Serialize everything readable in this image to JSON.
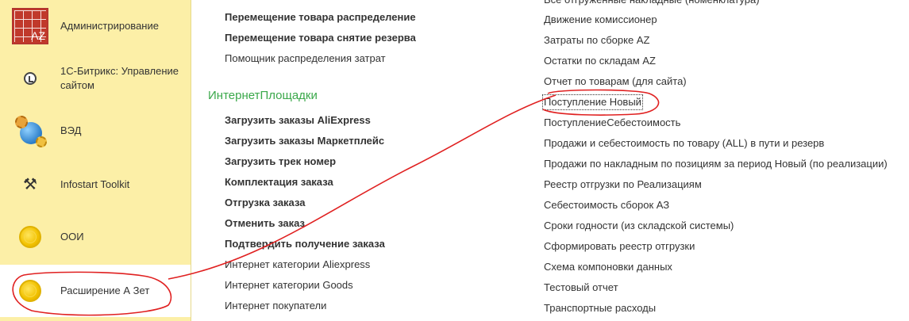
{
  "sidebar": {
    "items": [
      {
        "label": "Администрирование",
        "icon": "az-logo-icon"
      },
      {
        "label": "1С-Битрикс: Управление сайтом",
        "icon": "bitrix-icon"
      },
      {
        "label": "ВЭД",
        "icon": "globe-gears-icon"
      },
      {
        "label": "Infostart Toolkit",
        "icon": "tools-icon"
      },
      {
        "label": "ООИ",
        "icon": "coin-icon"
      },
      {
        "label": "Расширение А Зет",
        "icon": "coin-icon"
      }
    ],
    "active_index": 5
  },
  "column1": {
    "top_items": [
      {
        "label": "Перемещение товара распределение",
        "bold": true
      },
      {
        "label": "Перемещение товара снятие резерва",
        "bold": true
      },
      {
        "label": "Помощник распределения затрат",
        "bold": false
      }
    ],
    "section_title": "ИнтернетПлощадки",
    "section_items": [
      {
        "label": "Загрузить заказы AliExpress",
        "bold": true
      },
      {
        "label": "Загрузить заказы Маркетплейс",
        "bold": true
      },
      {
        "label": "Загрузить трек номер",
        "bold": true
      },
      {
        "label": "Комплектация заказа",
        "bold": true
      },
      {
        "label": "Отгрузка заказа",
        "bold": true
      },
      {
        "label": "Отменить заказ",
        "bold": true
      },
      {
        "label": "Подтвердить получение заказа",
        "bold": true
      },
      {
        "label": "Интернет категории Aliexpress",
        "bold": false
      },
      {
        "label": "Интернет категории Goods",
        "bold": false
      },
      {
        "label": "Интернет покупатели",
        "bold": false
      }
    ]
  },
  "column2": {
    "items": [
      {
        "label": "Все отгруженные накладные (номенклатура)"
      },
      {
        "label": "Движение комиссионер"
      },
      {
        "label": "Затраты по сборке AZ"
      },
      {
        "label": "Остатки по складам AZ"
      },
      {
        "label": "Отчет по товарам (для сайта)"
      },
      {
        "label": "Поступление Новый"
      },
      {
        "label": "ПоступлениеСебестоимость"
      },
      {
        "label": "Продажи и себестоимость по товару (ALL) в пути и резерв"
      },
      {
        "label": "Продажи по накладным по позициям за период Новый (по реализации)"
      },
      {
        "label": "Реестр отгрузки по Реализациям"
      },
      {
        "label": "Себестоимость сборок АЗ"
      },
      {
        "label": "Сроки годности (из складской системы)"
      },
      {
        "label": "Сформировать реестр отгрузки"
      },
      {
        "label": "Схема компоновки данных"
      },
      {
        "label": "Тестовый отчет"
      },
      {
        "label": "Транспортные расходы"
      }
    ],
    "focused_index": 5
  },
  "colors": {
    "sidebar_bg": "#fcefa7",
    "section_title": "#3aa84a",
    "annotation": "#e02020"
  }
}
